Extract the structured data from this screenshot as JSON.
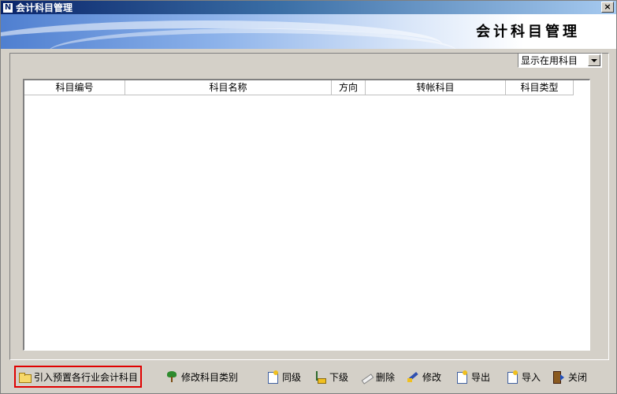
{
  "window": {
    "title": "会计科目管理",
    "app_icon_glyph": "N",
    "close_glyph": "×"
  },
  "banner": {
    "title": "会计科目管理"
  },
  "filter": {
    "selected": "显示在用科目"
  },
  "grid": {
    "columns": [
      "科目编号",
      "科目名称",
      "方向",
      "转帐科目",
      "科目类型"
    ],
    "rows": []
  },
  "toolbar": {
    "import_preset": "引入预置各行业会计科目",
    "edit_category": "修改科目类别",
    "sibling": "同级",
    "child": "下级",
    "delete": "删除",
    "modify": "修改",
    "export": "导出",
    "import": "导入",
    "close": "关闭"
  },
  "icons": {
    "import_preset": "folder-open-icon",
    "edit_category": "tree-icon",
    "sibling": "new-doc-icon",
    "child": "sub-level-icon",
    "delete": "eraser-icon",
    "modify": "pencil-icon",
    "export": "export-doc-icon",
    "import": "import-doc-icon",
    "close": "exit-door-icon"
  },
  "colors": {
    "highlight_border": "#e00000",
    "titlebar": "#0a246a",
    "face": "#d4d0c8"
  }
}
